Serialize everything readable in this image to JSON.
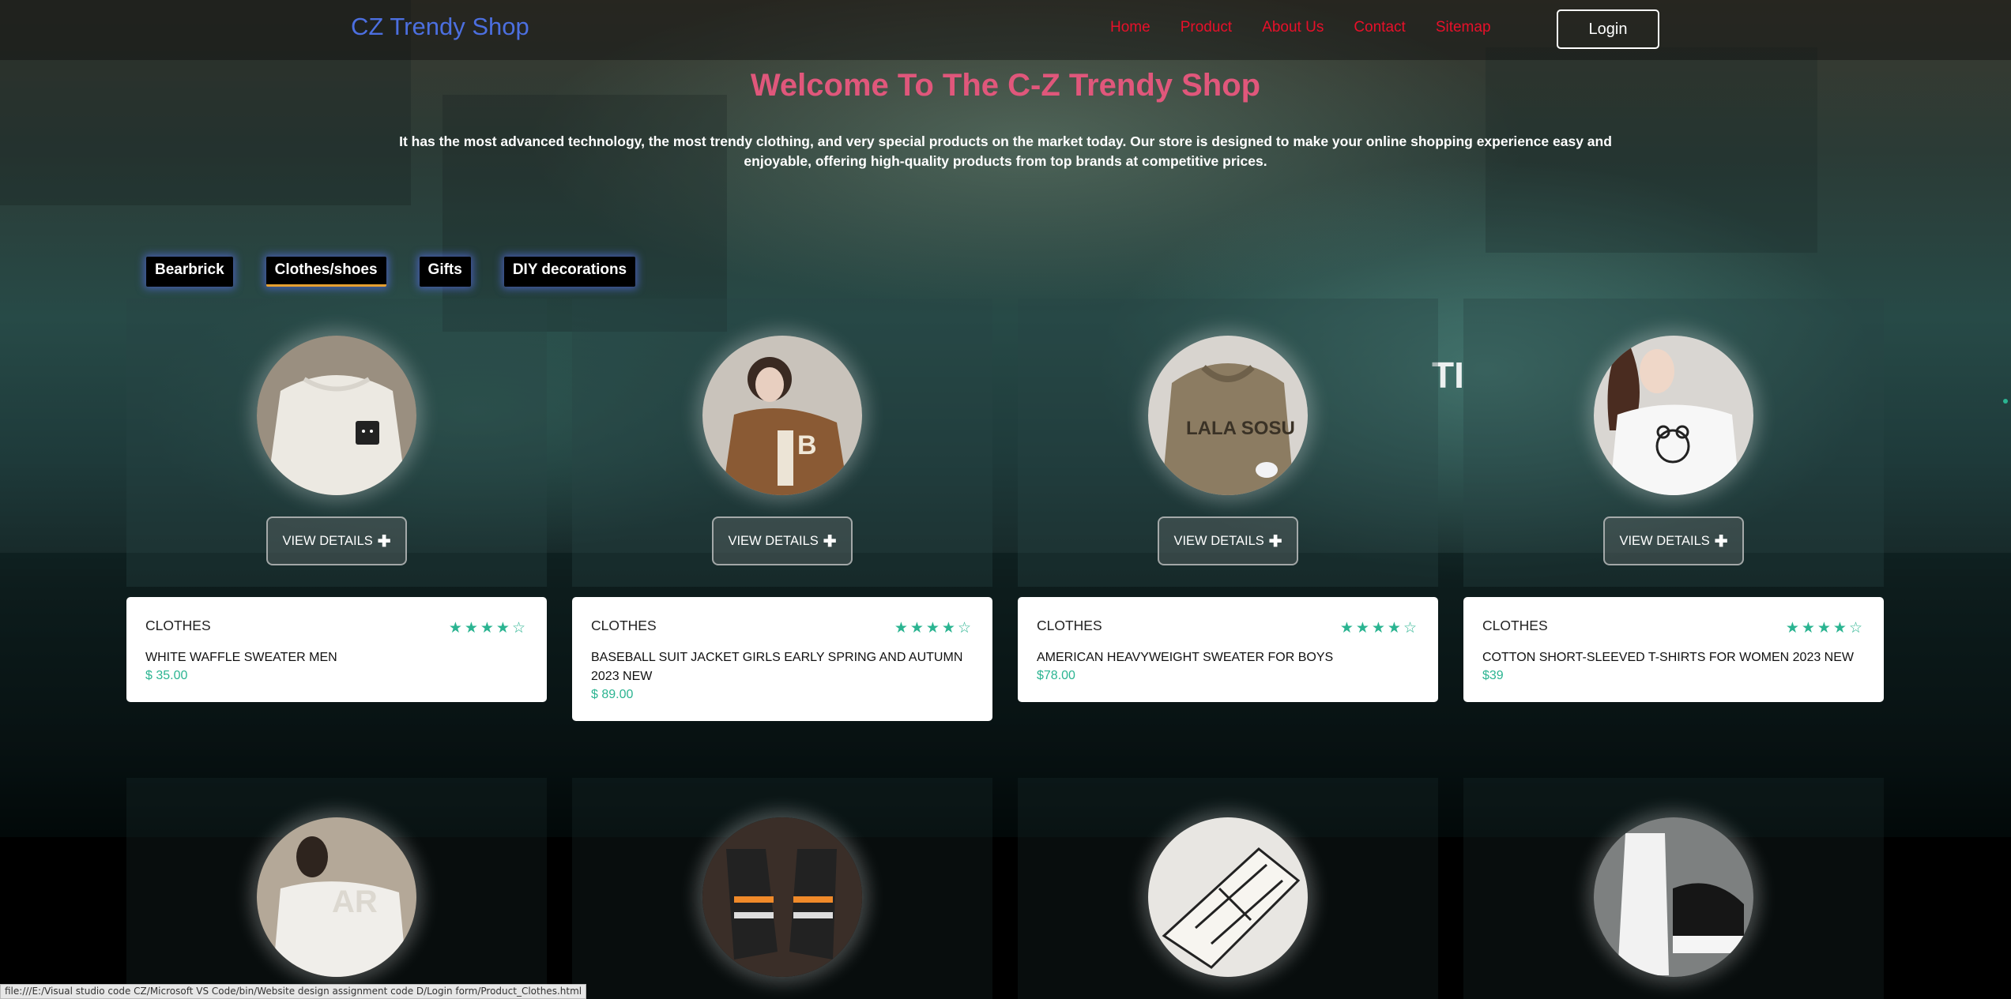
{
  "brand": "CZ Trendy Shop",
  "nav": {
    "items": [
      "Home",
      "Product",
      "About Us",
      "Contact",
      "Sitemap"
    ],
    "login_label": "Login"
  },
  "hero": {
    "title": "Welcome To The C-Z Trendy Shop",
    "description": "It has the most advanced technology, the most trendy clothing, and very special products on the market today. Our store is designed to make your online shopping experience easy and enjoyable, offering high-quality products from top brands at competitive prices."
  },
  "tabs": [
    {
      "label": "Bearbrick",
      "active": false
    },
    {
      "label": "Clothes/shoes",
      "active": true
    },
    {
      "label": "Gifts",
      "active": false
    },
    {
      "label": "DIY decorations",
      "active": false
    }
  ],
  "view_details_label": "VIEW DETAILS",
  "products": [
    {
      "category": "CLOTHES",
      "name": "WHITE WAFFLE SWEATER MEN",
      "price": "$ 35.00",
      "rating": 4
    },
    {
      "category": "CLOTHES",
      "name": "BASEBALL SUIT JACKET GIRLS EARLY SPRING AND AUTUMN 2023 NEW",
      "price": "$ 89.00",
      "rating": 4
    },
    {
      "category": "CLOTHES",
      "name": "AMERICAN HEAVYWEIGHT SWEATER FOR BOYS",
      "price": "$78.00",
      "rating": 4
    },
    {
      "category": "CLOTHES",
      "name": "COTTON SHORT-SLEEVED T-SHIRTS FOR WOMEN 2023 NEW",
      "price": "$39",
      "rating": 4
    }
  ],
  "status_url": "file:///E:/Visual studio code CZ/Microsoft VS Code/bin/Website design assignment code D/Login form/Product_Clothes.html",
  "colors": {
    "brand": "#4c6fe0",
    "nav_link": "#e8102a",
    "hero_title": "#e0577b",
    "accent_green": "#2bb491",
    "tab_underline": "#e6a030"
  }
}
